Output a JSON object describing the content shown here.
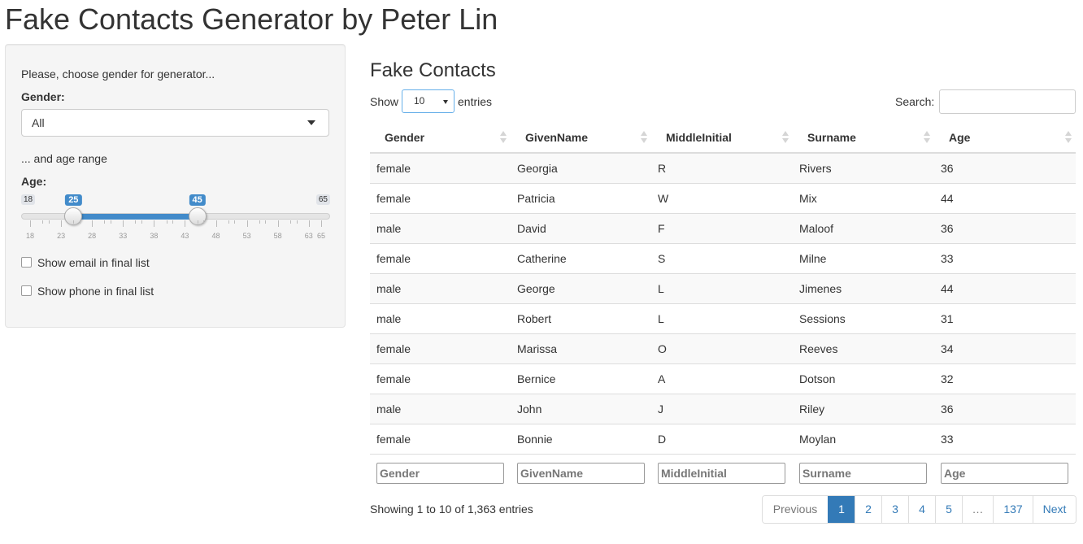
{
  "app": {
    "title": "Fake Contacts Generator by Peter Lin"
  },
  "sidebar": {
    "intro": "Please, choose gender for generator...",
    "gender_label": "Gender:",
    "gender_value": "All",
    "age_intro": "... and age range",
    "age_label": "Age:",
    "slider": {
      "min": 18,
      "max": 65,
      "from": 25,
      "to": 45,
      "min_label": "18",
      "max_label": "65",
      "from_label": "25",
      "to_label": "45",
      "tick_labels": [
        "18",
        "23",
        "28",
        "33",
        "38",
        "43",
        "48",
        "53",
        "58",
        "63",
        "65"
      ]
    },
    "email_checkbox": {
      "label": "Show email in final list",
      "checked": false
    },
    "phone_checkbox": {
      "label": "Show phone in final list",
      "checked": false
    }
  },
  "main": {
    "title": "Fake Contacts",
    "show_label": "Show",
    "entries_label": "entries",
    "page_length": "10",
    "search_label": "Search:",
    "search_value": "",
    "columns": [
      "Gender",
      "GivenName",
      "MiddleInitial",
      "Surname",
      "Age"
    ],
    "rows": [
      [
        "female",
        "Georgia",
        "R",
        "Rivers",
        "36"
      ],
      [
        "female",
        "Patricia",
        "W",
        "Mix",
        "44"
      ],
      [
        "male",
        "David",
        "F",
        "Maloof",
        "36"
      ],
      [
        "female",
        "Catherine",
        "S",
        "Milne",
        "33"
      ],
      [
        "male",
        "George",
        "L",
        "Jimenes",
        "44"
      ],
      [
        "male",
        "Robert",
        "L",
        "Sessions",
        "31"
      ],
      [
        "female",
        "Marissa",
        "O",
        "Reeves",
        "34"
      ],
      [
        "female",
        "Bernice",
        "A",
        "Dotson",
        "32"
      ],
      [
        "male",
        "John",
        "J",
        "Riley",
        "36"
      ],
      [
        "female",
        "Bonnie",
        "D",
        "Moylan",
        "33"
      ]
    ],
    "footer_filters": [
      "Gender",
      "GivenName",
      "MiddleInitial",
      "Surname",
      "Age"
    ],
    "info": "Showing 1 to 10 of 1,363 entries",
    "pagination": {
      "previous": "Previous",
      "pages": [
        "1",
        "2",
        "3",
        "4",
        "5",
        "…",
        "137"
      ],
      "current": "1",
      "next": "Next"
    }
  },
  "colors": {
    "accent": "#337ab7",
    "slider": "#428bca"
  }
}
